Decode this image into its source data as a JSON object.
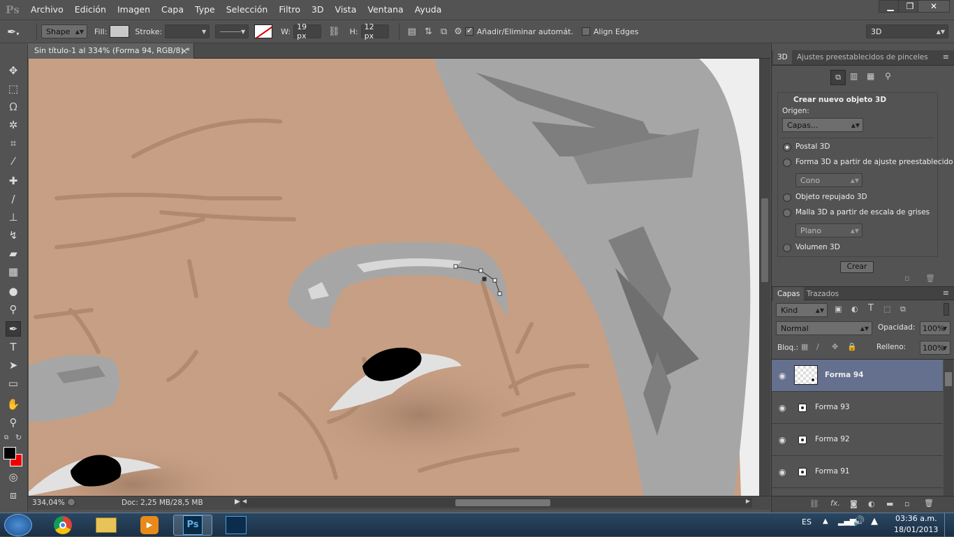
{
  "app": {
    "logo": "Ps"
  },
  "menu": [
    "Archivo",
    "Edición",
    "Imagen",
    "Capa",
    "Type",
    "Selección",
    "Filtro",
    "3D",
    "Vista",
    "Ventana",
    "Ayuda"
  ],
  "window_controls": {
    "minimize": "▁",
    "restore": "❐",
    "close": "✕"
  },
  "options": {
    "mode": "Shape",
    "fill_label": "Fill:",
    "stroke_label": "Stroke:",
    "w_label": "W:",
    "w_value": "19 px",
    "h_label": "H:",
    "h_value": "12 px",
    "auto_add_delete": "Añadir/Eliminar automát.",
    "align_edges": "Align Edges",
    "workspace": "3D",
    "colors": {
      "fill": "#c9c9c9"
    }
  },
  "document": {
    "tab_title": "Sin título-1 al 334% (Forma 94, RGB/8) *",
    "close": "×"
  },
  "status": {
    "zoom": "334,04%",
    "doc_info": "Doc: 2,25 MB/28,5 MB"
  },
  "panel3d": {
    "tab_3d": "3D",
    "tab_brushes": "Ajustes preestablecidos de pinceles",
    "section_title": "Crear nuevo objeto 3D",
    "origin_label": "Origen:",
    "origin_value": "Capas...",
    "options": [
      {
        "label": "Postal 3D",
        "selected": true
      },
      {
        "label": "Forma 3D a partir de ajuste preestablecido",
        "selected": false
      },
      {
        "label": "Objeto repujado 3D",
        "selected": false
      },
      {
        "label": "Malla 3D a partir de escala de grises",
        "selected": false
      },
      {
        "label": "Volumen 3D",
        "selected": false
      }
    ],
    "preset_value": "Cono",
    "grayscale_value": "Plano",
    "create_button": "Crear"
  },
  "layers_panel": {
    "tab_layers": "Capas",
    "tab_paths": "Trazados",
    "filter_kind": "Kind",
    "blend_mode": "Normal",
    "opacity_label": "Opacidad:",
    "opacity_value": "100%",
    "lock_label": "Bloq.:",
    "fill_label": "Relleno:",
    "fill_value": "100%",
    "layers": [
      {
        "name": "Forma 94",
        "selected": true
      },
      {
        "name": "Forma 93",
        "selected": false
      },
      {
        "name": "Forma 92",
        "selected": false
      },
      {
        "name": "Forma 91",
        "selected": false
      }
    ]
  },
  "taskbar": {
    "language": "ES",
    "time": "03:36 a.m.",
    "date": "18/01/2013",
    "ps_label": "Ps"
  }
}
